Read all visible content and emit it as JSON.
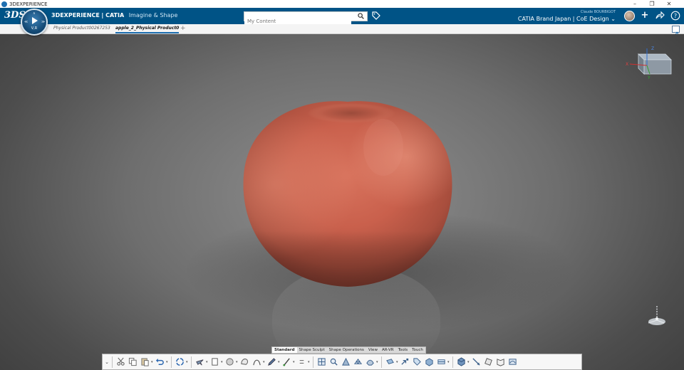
{
  "window": {
    "title": "3DEXPERIENCE",
    "controls": [
      "minimize",
      "maximize",
      "close"
    ]
  },
  "topbar": {
    "brand_strong": "3DEXPERIENCE",
    "brand_app": "| CATIA",
    "app_name": "Imagine & Shape",
    "search": {
      "placeholder": "My Content",
      "value": ""
    },
    "user_name": "Claude BOURBIGOT",
    "workspace": "CATIA Brand Japan | CoE Design",
    "icons": [
      "tag-icon",
      "avatar",
      "add-icon",
      "share-icon",
      "help-icon"
    ]
  },
  "compass": {
    "label": "V,R"
  },
  "tabs": [
    {
      "label": "Physical Product00267253",
      "active": false
    },
    {
      "label": "apple_2_Physical Product0",
      "active": true
    }
  ],
  "viewport": {
    "object": "apple",
    "colors": {
      "apple": "#c9604c",
      "background": "#6f6f6f"
    },
    "viewcube_axes": {
      "x": "X",
      "y": "Y",
      "z": "Z"
    }
  },
  "section_tabs": [
    {
      "label": "Standard",
      "active": true
    },
    {
      "label": "Shape Sculpt",
      "active": false
    },
    {
      "label": "Shape Operations",
      "active": false
    },
    {
      "label": "View",
      "active": false
    },
    {
      "label": "AR-VR",
      "active": false
    },
    {
      "label": "Tools",
      "active": false
    },
    {
      "label": "Touch",
      "active": false
    }
  ],
  "action_bar": {
    "icons": [
      "cut-icon",
      "copy-icon",
      "paste-icon",
      "undo-icon",
      "update-icon",
      "airplane-icon",
      "sketch-icon",
      "sphere-icon",
      "subdivision-icon",
      "curve-icon",
      "pencil-icon",
      "brush-icon",
      "equals-icon",
      "grid-icon",
      "magnifier-icon",
      "sculpt-icon",
      "mesh-icon",
      "surface-icon",
      "plane-icon",
      "arrow-icon",
      "tag-icon",
      "box-icon",
      "patch-icon",
      "cube-icon",
      "dimension-icon",
      "grab-icon",
      "book-icon",
      "render-icon"
    ]
  }
}
